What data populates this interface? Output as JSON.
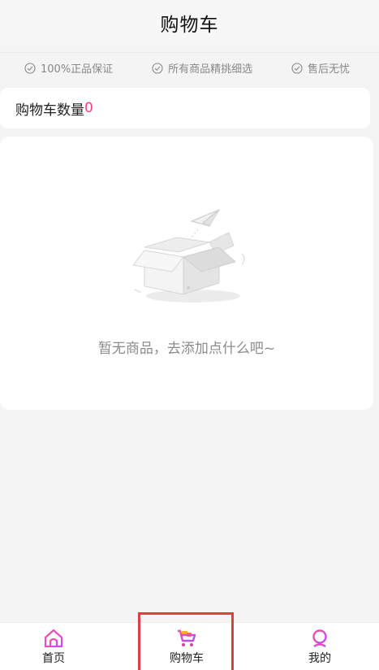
{
  "header": {
    "title": "购物车"
  },
  "guarantees": [
    {
      "label": "100%正品保证",
      "icon": "check-circle-icon"
    },
    {
      "label": "所有商品精挑细选",
      "icon": "check-circle-icon"
    },
    {
      "label": "售后无忧",
      "icon": "check-circle-icon"
    }
  ],
  "cart": {
    "count_label": "购物车数量",
    "count_value": "0",
    "empty_text": "暂无商品，去添加点什么吧~",
    "empty_icon": "empty-box-icon"
  },
  "bottom_nav": {
    "items": [
      {
        "label": "首页",
        "icon": "home-icon"
      },
      {
        "label": "购物车",
        "icon": "cart-icon",
        "active": true
      },
      {
        "label": "我的",
        "icon": "profile-icon"
      }
    ]
  },
  "colors": {
    "accent": "#ff3d7f",
    "highlight": "#e23c3c"
  }
}
